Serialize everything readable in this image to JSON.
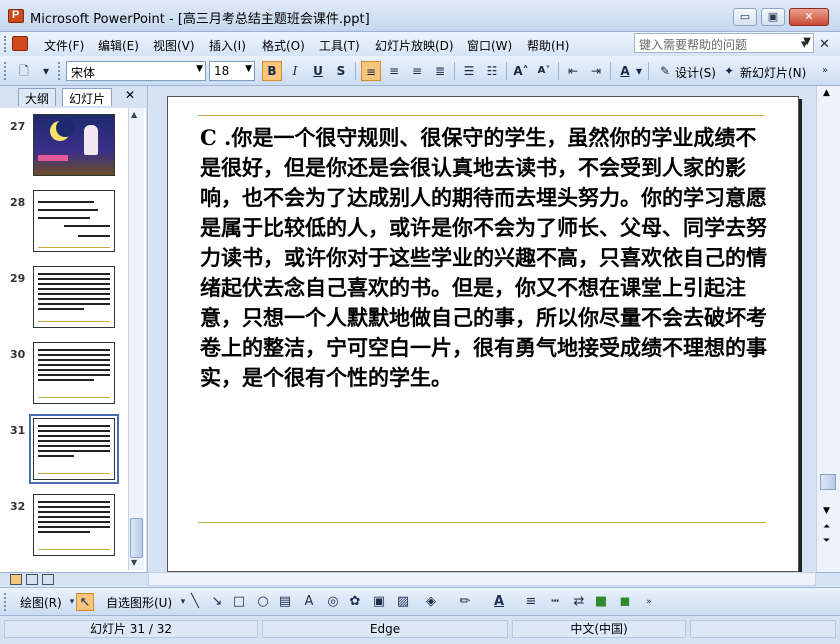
{
  "window": {
    "title": "Microsoft PowerPoint - [高三月考总结主题班会课件.ppt]",
    "minimize_glyph": "▭",
    "maximize_glyph": "▣",
    "close_glyph": "✕"
  },
  "menu": {
    "items": [
      "文件(F)",
      "编辑(E)",
      "视图(V)",
      "插入(I)",
      "格式(O)",
      "工具(T)",
      "幻灯片放映(D)",
      "窗口(W)",
      "帮助(H)"
    ],
    "help_placeholder": "键入需要帮助的问题",
    "mdi_buttons": [
      "▾",
      "✕"
    ]
  },
  "toolbar": {
    "font_name": "宋体",
    "font_size": "18",
    "bold": "B",
    "italic": "I",
    "underline": "U",
    "shadow": "S",
    "design_label": "设计(S)",
    "new_slide_label": "新幻灯片(N)"
  },
  "left_pane": {
    "tabs": [
      "大纲",
      "幻灯片"
    ],
    "close_glyph": "✕",
    "slide_numbers": [
      "27",
      "28",
      "29",
      "30",
      "31",
      "32"
    ],
    "selected_slide": "31"
  },
  "slide": {
    "body_text": "C .你是一个很守规则、很保守的学生，虽然你的学业成绩不是很好，但是你还是会很认真地去读书，不会受到人家的影响，也不会为了达成别人的期待而去埋头努力。你的学习意愿是属于比较低的人，或许是你不会为了师长、父母、同学去努力读书，或许你对于这些学业的兴趣不高，只喜欢依自己的情绪起伏去念自己喜欢的书。但是，你又不想在课堂上引起注意，只想一个人默默地做自己的事，所以你尽量不会去破坏考卷上的整洁，宁可空白一片，很有勇气地接受成绩不理想的事实，是个很有个性的学生。"
  },
  "draw_toolbar": {
    "draw_label": "绘图(R)",
    "autoshape_label": "自选图形(U)"
  },
  "status": {
    "slide_position": "幻灯片 31 / 32",
    "design_name": "Edge",
    "language": "中文(中国)"
  },
  "colors": {
    "accent": "#c9a93b",
    "selection": "#4a6ea9",
    "toolbar_bg": "#dbe8f9"
  }
}
